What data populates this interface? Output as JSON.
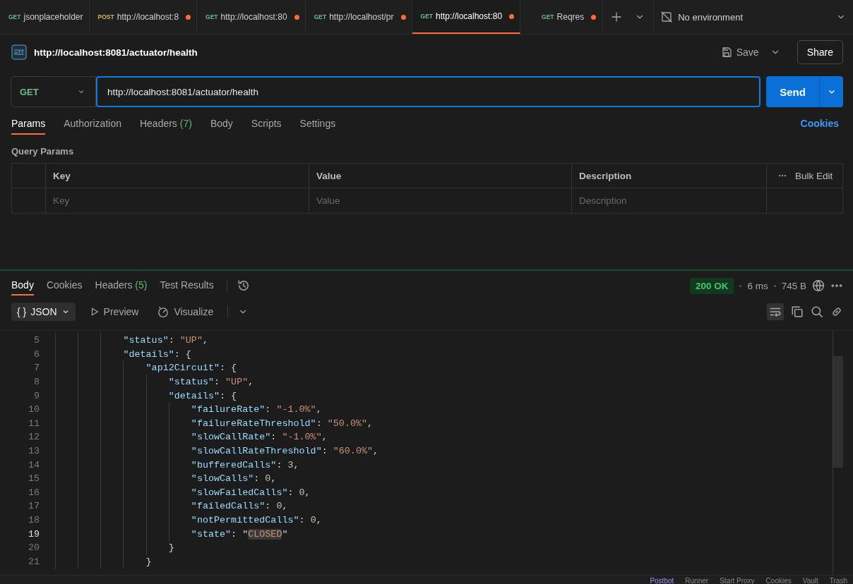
{
  "request_tabs": [
    {
      "method": "GET",
      "color": "#6bbd8a",
      "label": "jsonplaceholder",
      "unsaved": false,
      "selected": false
    },
    {
      "method": "POST",
      "color": "#d6b656",
      "label": "http://localhost:8",
      "unsaved": true,
      "selected": false
    },
    {
      "method": "GET",
      "color": "#6bbd8a",
      "label": "http://localhost:80",
      "unsaved": true,
      "selected": false
    },
    {
      "method": "GET",
      "color": "#6bbd8a",
      "label": "http://localhost/pr",
      "unsaved": true,
      "selected": false
    },
    {
      "method": "GET",
      "color": "#6bbd8a",
      "label": "http://localhost:80",
      "unsaved": true,
      "selected": true
    },
    {
      "method": "GET",
      "color": "#6bbd8a",
      "label": "Reqres",
      "unsaved": true,
      "selected": false
    }
  ],
  "environment": "No environment",
  "request_title": "http://localhost:8081/actuator/health",
  "save_label": "Save",
  "share_label": "Share",
  "method": "GET",
  "url": "http://localhost:8081/actuator/health",
  "send_label": "Send",
  "request_sections": [
    {
      "label": "Params",
      "selected": true
    },
    {
      "label": "Authorization",
      "selected": false
    },
    {
      "label": "Headers",
      "count": "(7)",
      "selected": false
    },
    {
      "label": "Body",
      "selected": false
    },
    {
      "label": "Scripts",
      "selected": false
    },
    {
      "label": "Settings",
      "selected": false
    }
  ],
  "cookies_link": "Cookies",
  "query_params": {
    "title": "Query Params",
    "columns": [
      "Key",
      "Value",
      "Description"
    ],
    "bulk_edit": "Bulk Edit",
    "placeholders": [
      "Key",
      "Value",
      "Description"
    ]
  },
  "response_tabs": [
    {
      "label": "Body",
      "selected": true
    },
    {
      "label": "Cookies",
      "selected": false
    },
    {
      "label": "Headers",
      "count": "(5)",
      "selected": false
    },
    {
      "label": "Test Results",
      "selected": false
    }
  ],
  "response_status": {
    "status": "200 OK",
    "time": "6 ms",
    "size": "745 B"
  },
  "body_toolbar": {
    "format": "JSON",
    "format_prefix": "{ }",
    "preview": "Preview",
    "visualize": "Visualize"
  },
  "code_lines": [
    {
      "number": "5",
      "current": false,
      "tokens": [
        {
          "kind": "key",
          "text": "            \"status\""
        },
        {
          "kind": "punct",
          "text": ": "
        },
        {
          "kind": "string",
          "text": "\"UP\""
        },
        {
          "kind": "punct",
          "text": ","
        }
      ]
    },
    {
      "number": "6",
      "current": false,
      "tokens": [
        {
          "kind": "key",
          "text": "            \"details\""
        },
        {
          "kind": "punct",
          "text": ": {"
        }
      ]
    },
    {
      "number": "7",
      "current": false,
      "tokens": [
        {
          "kind": "key",
          "text": "                \"api2Circuit\""
        },
        {
          "kind": "punct",
          "text": ": {"
        }
      ]
    },
    {
      "number": "8",
      "current": false,
      "tokens": [
        {
          "kind": "key",
          "text": "                    \"status\""
        },
        {
          "kind": "punct",
          "text": ": "
        },
        {
          "kind": "string",
          "text": "\"UP\""
        },
        {
          "kind": "punct",
          "text": ","
        }
      ]
    },
    {
      "number": "9",
      "current": false,
      "tokens": [
        {
          "kind": "key",
          "text": "                    \"details\""
        },
        {
          "kind": "punct",
          "text": ": {"
        }
      ]
    },
    {
      "number": "10",
      "current": false,
      "tokens": [
        {
          "kind": "key",
          "text": "                        \"failureRate\""
        },
        {
          "kind": "punct",
          "text": ": "
        },
        {
          "kind": "string",
          "text": "\"-1.0%\""
        },
        {
          "kind": "punct",
          "text": ","
        }
      ]
    },
    {
      "number": "11",
      "current": false,
      "tokens": [
        {
          "kind": "key",
          "text": "                        \"failureRateThreshold\""
        },
        {
          "kind": "punct",
          "text": ": "
        },
        {
          "kind": "string",
          "text": "\"50.0%\""
        },
        {
          "kind": "punct",
          "text": ","
        }
      ]
    },
    {
      "number": "12",
      "current": false,
      "tokens": [
        {
          "kind": "key",
          "text": "                        \"slowCallRate\""
        },
        {
          "kind": "punct",
          "text": ": "
        },
        {
          "kind": "string",
          "text": "\"-1.0%\""
        },
        {
          "kind": "punct",
          "text": ","
        }
      ]
    },
    {
      "number": "13",
      "current": false,
      "tokens": [
        {
          "kind": "key",
          "text": "                        \"slowCallRateThreshold\""
        },
        {
          "kind": "punct",
          "text": ": "
        },
        {
          "kind": "string",
          "text": "\"60.0%\""
        },
        {
          "kind": "punct",
          "text": ","
        }
      ]
    },
    {
      "number": "14",
      "current": false,
      "tokens": [
        {
          "kind": "key",
          "text": "                        \"bufferedCalls\""
        },
        {
          "kind": "punct",
          "text": ": "
        },
        {
          "kind": "number",
          "text": "3"
        },
        {
          "kind": "punct",
          "text": ","
        }
      ]
    },
    {
      "number": "15",
      "current": false,
      "tokens": [
        {
          "kind": "key",
          "text": "                        \"slowCalls\""
        },
        {
          "kind": "punct",
          "text": ": "
        },
        {
          "kind": "number",
          "text": "0"
        },
        {
          "kind": "punct",
          "text": ","
        }
      ]
    },
    {
      "number": "16",
      "current": false,
      "tokens": [
        {
          "kind": "key",
          "text": "                        \"slowFailedCalls\""
        },
        {
          "kind": "punct",
          "text": ": "
        },
        {
          "kind": "number",
          "text": "0"
        },
        {
          "kind": "punct",
          "text": ","
        }
      ]
    },
    {
      "number": "17",
      "current": false,
      "tokens": [
        {
          "kind": "key",
          "text": "                        \"failedCalls\""
        },
        {
          "kind": "punct",
          "text": ": "
        },
        {
          "kind": "number",
          "text": "0"
        },
        {
          "kind": "punct",
          "text": ","
        }
      ]
    },
    {
      "number": "18",
      "current": false,
      "tokens": [
        {
          "kind": "key",
          "text": "                        \"notPermittedCalls\""
        },
        {
          "kind": "punct",
          "text": ": "
        },
        {
          "kind": "number",
          "text": "0"
        },
        {
          "kind": "punct",
          "text": ","
        }
      ]
    },
    {
      "number": "19",
      "current": true,
      "tokens": [
        {
          "kind": "key",
          "text": "                        \"state\""
        },
        {
          "kind": "punct",
          "text": ": \""
        },
        {
          "kind": "highlight",
          "text": "CLOSED"
        },
        {
          "kind": "punct",
          "text": "\""
        }
      ]
    },
    {
      "number": "20",
      "current": false,
      "tokens": [
        {
          "kind": "punct",
          "text": "                    }"
        }
      ]
    },
    {
      "number": "21",
      "current": false,
      "tokens": [
        {
          "kind": "punct",
          "text": "                }"
        }
      ]
    }
  ],
  "status_bar": [
    "Postbot",
    "Runner",
    "Start Proxy",
    "Cookies",
    "Vault",
    "Trash"
  ]
}
